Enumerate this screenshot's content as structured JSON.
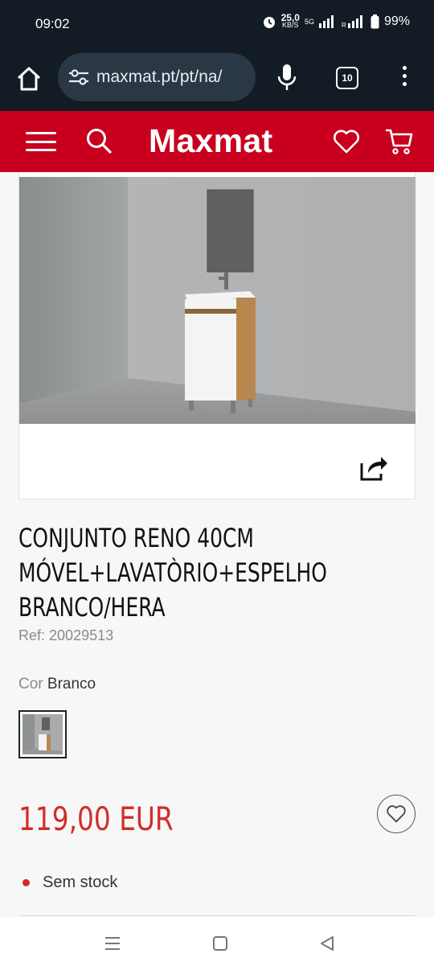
{
  "status": {
    "time": "09:02",
    "speed_value": "25,0",
    "speed_unit": "KB/S",
    "network": "5G",
    "battery": "99%"
  },
  "browser": {
    "url": "maxmat.pt/pt/na/",
    "tab_count": "10"
  },
  "header": {
    "logo": "Maxmat",
    "background": "#c8001e"
  },
  "product": {
    "title": "CONJUNTO RENO 40CM MÓVEL+LAVATÒRIO+ESPELHO BRANCO/HERA",
    "ref_label": "Ref:",
    "ref_value": "20029513",
    "color_label": "Cor",
    "color_value": "Branco",
    "price": "119,00 EUR",
    "price_color": "#d42b2b",
    "stock": "Sem stock"
  },
  "icons": {
    "home": "home-icon",
    "site_settings": "tune-icon",
    "mic": "microphone-icon",
    "menu": "more-vert-icon",
    "hamburger": "hamburger-icon",
    "search": "search-icon",
    "wishlist": "heart-icon",
    "cart": "cart-icon",
    "share": "share-icon"
  }
}
